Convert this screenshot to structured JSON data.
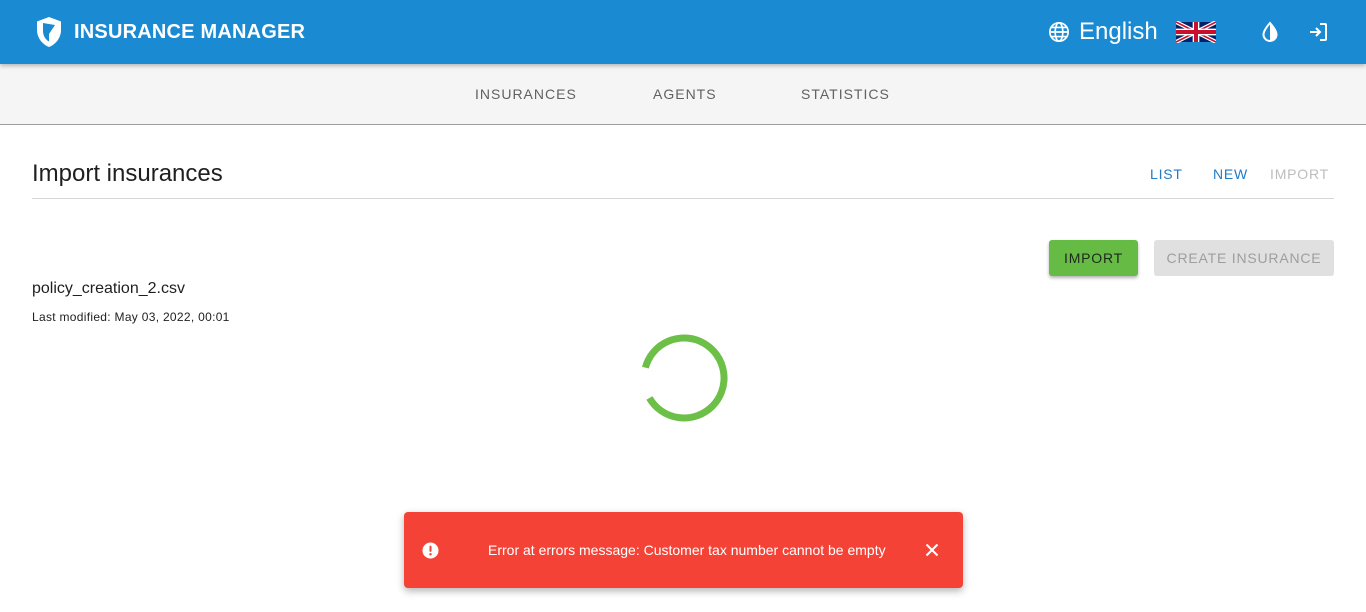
{
  "header": {
    "brand_title": "INSURANCE MANAGER",
    "brand_icon": "shield-logo-icon",
    "language_label": "English",
    "language_flag": "uk-flag-icon",
    "theme_icon": "contrast-icon",
    "logout_icon": "logout-icon",
    "background_color": "#1a8bd3"
  },
  "tabs": [
    {
      "label": "INSURANCES"
    },
    {
      "label": "AGENTS"
    },
    {
      "label": "STATISTICS"
    }
  ],
  "page": {
    "title": "Import insurances",
    "subnav": {
      "list_label": "LIST",
      "new_label": "NEW",
      "import_label": "IMPORT"
    },
    "actions": {
      "import_label": "IMPORT",
      "create_label": "CREATE INSURANCE",
      "import_color": "#66bb45"
    },
    "file": {
      "name": "policy_creation_2.csv",
      "last_modified": "Last modified: May 03, 2022, 00:01"
    },
    "loading_spinner_color": "#6cbf47"
  },
  "snackbar": {
    "icon": "alert-circle-icon",
    "message": "Error at errors message: Customer tax number cannot be empty",
    "close_icon": "close-icon",
    "background_color": "#f44336"
  }
}
